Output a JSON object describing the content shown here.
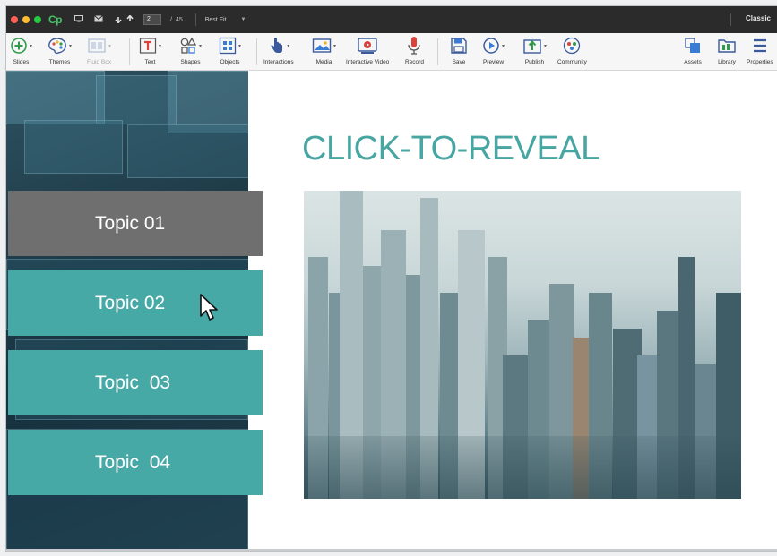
{
  "titlebar": {
    "app_logo": "Cp",
    "current_page": "2",
    "page_separator": "/",
    "total_pages": "45",
    "zoom": "Best Fit",
    "mode": "Classic",
    "lights": [
      "#ff5f57",
      "#febc2e",
      "#28c840"
    ]
  },
  "toolbar": {
    "slides": "Slides",
    "themes": "Themes",
    "fluid_box": "Fluid Box",
    "text": "Text",
    "shapes": "Shapes",
    "objects": "Objects",
    "interactions": "Interactions",
    "media": "Media",
    "interactive_video": "Interactive Video",
    "record": "Record",
    "save": "Save",
    "preview": "Preview",
    "publish": "Publish",
    "community": "Community",
    "assets": "Assets",
    "library": "Library",
    "properties": "Properties"
  },
  "slide": {
    "title": "CLICK-TO-REVEAL",
    "topics": [
      {
        "label": "Topic 01",
        "state": "active"
      },
      {
        "label": "Topic 02",
        "state": "normal"
      },
      {
        "label": "Topic  03",
        "state": "normal"
      },
      {
        "label": "Topic  04",
        "state": "normal"
      }
    ],
    "colors": {
      "teal": "#47a9a6",
      "active_gray": "#6f6f6f",
      "title_teal": "#47a5a2"
    }
  }
}
